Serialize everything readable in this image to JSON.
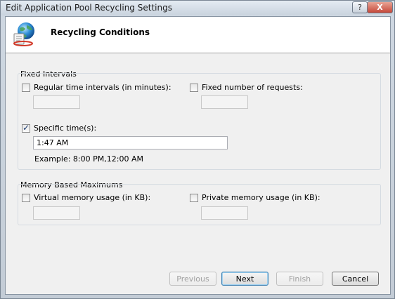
{
  "window": {
    "title": "Edit Application Pool Recycling Settings",
    "help_glyph": "?",
    "close_glyph": "X"
  },
  "header": {
    "title": "Recycling Conditions",
    "icon": "app-pool-globe-icon"
  },
  "fixed_intervals": {
    "title": "Fixed Intervals",
    "regular_time": {
      "label": "Regular time intervals (in minutes):",
      "checked": false,
      "value": ""
    },
    "fixed_requests": {
      "label": "Fixed number of requests:",
      "checked": false,
      "value": ""
    },
    "specific_times": {
      "label": "Specific time(s):",
      "checked": true,
      "value": "1:47 AM"
    },
    "example": "Example: 8:00 PM,12:00 AM"
  },
  "memory": {
    "title": "Memory Based Maximums",
    "virtual": {
      "label": "Virtual memory usage (in KB):",
      "checked": false,
      "value": ""
    },
    "private": {
      "label": "Private memory usage (in KB):",
      "checked": false,
      "value": ""
    }
  },
  "buttons": {
    "previous": "Previous",
    "next": "Next",
    "finish": "Finish",
    "cancel": "Cancel"
  }
}
